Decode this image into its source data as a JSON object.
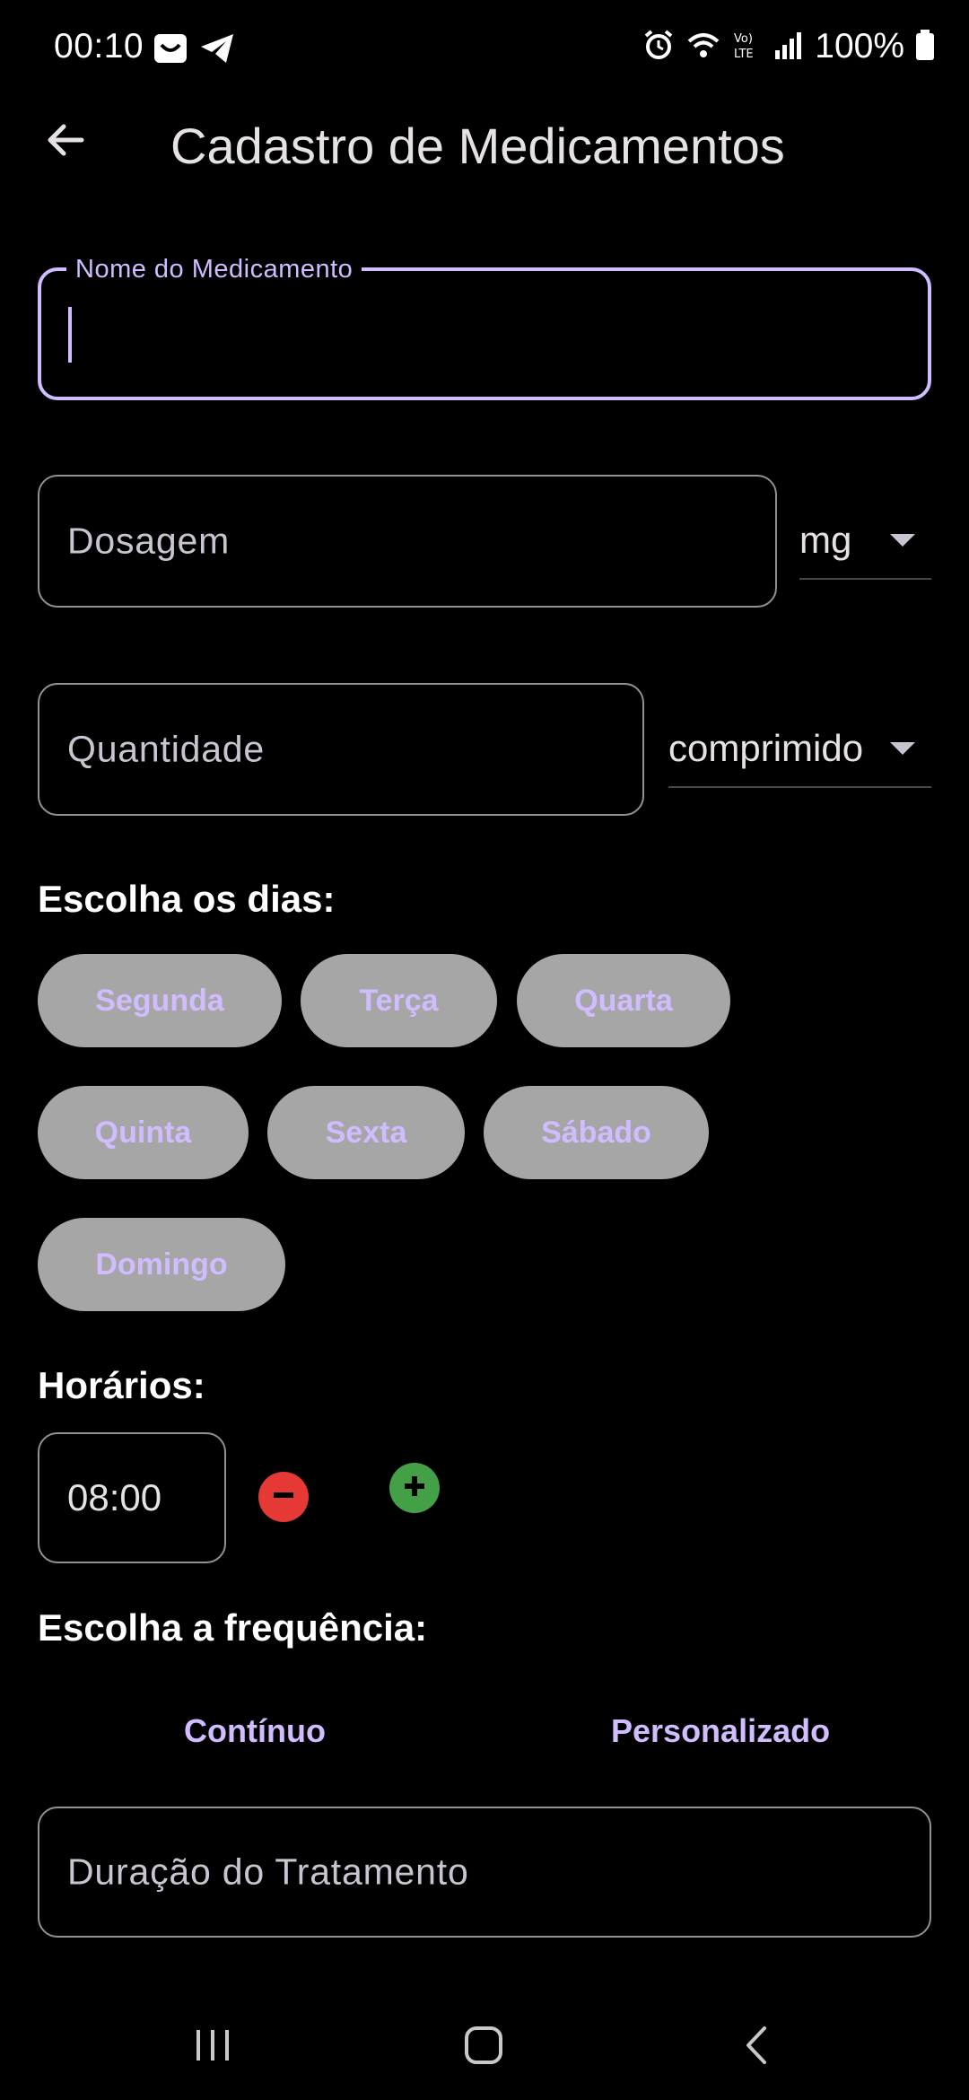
{
  "status_bar": {
    "time": "00:10",
    "battery": "100%",
    "left_icons": [
      "smile-notification-icon",
      "telegram-icon"
    ],
    "right_icons": [
      "alarm-icon",
      "wifi-icon",
      "volte-icon",
      "signal-icon",
      "battery-icon"
    ]
  },
  "app_bar": {
    "title": "Cadastro de Medicamentos",
    "back_icon": "arrow-back-icon"
  },
  "form": {
    "name_field": {
      "label": "Nome do Medicamento",
      "value": ""
    },
    "dosage_field": {
      "placeholder": "Dosagem",
      "unit": "mg"
    },
    "quantity_field": {
      "placeholder": "Quantidade",
      "unit": "comprimido"
    },
    "days_title": "Escolha os dias:",
    "days": [
      "Segunda",
      "Terça",
      "Quarta",
      "Quinta",
      "Sexta",
      "Sábado",
      "Domingo"
    ],
    "times_title": "Horários:",
    "times": [
      "08:00"
    ],
    "frequency_title": "Escolha a frequência:",
    "frequency_options": [
      "Contínuo",
      "Personalizado"
    ],
    "duration_field": {
      "placeholder": "Duração do Tratamento"
    }
  },
  "colors": {
    "background": "#000000",
    "accent": "#d0bcff",
    "chip_bg": "#a6a6a6",
    "remove": "#e53935",
    "add": "#43a047"
  }
}
